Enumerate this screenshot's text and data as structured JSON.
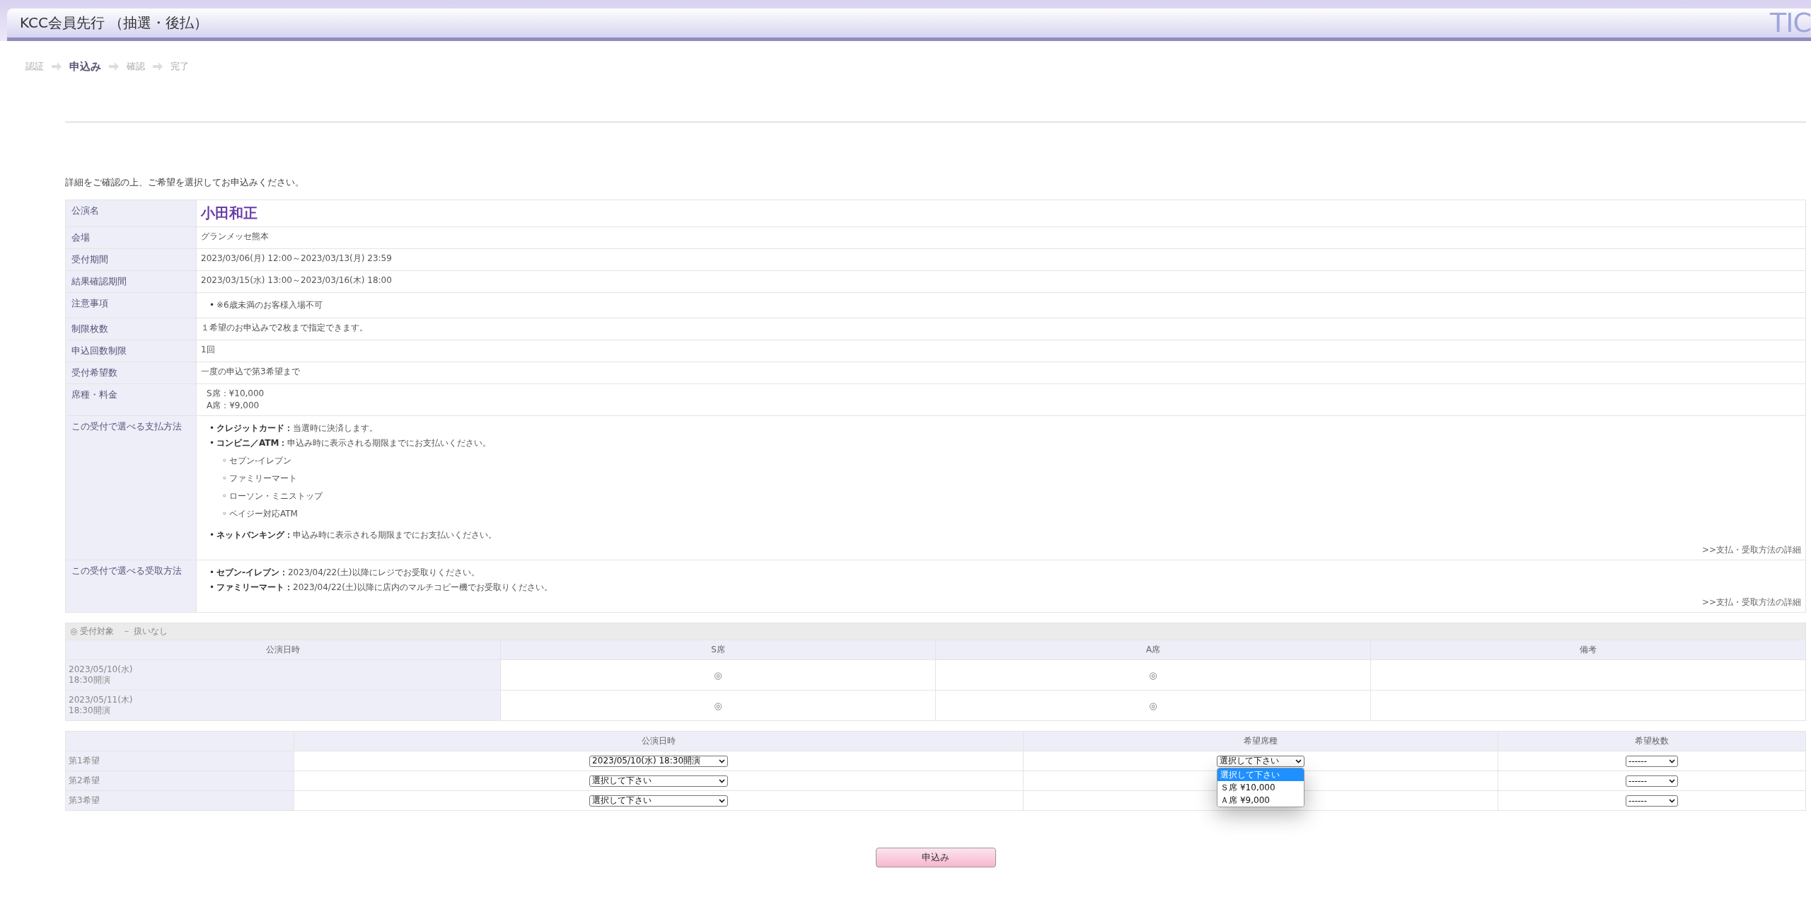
{
  "header": {
    "title": "KCC会員先行 （抽選・後払）",
    "logo": "TIC"
  },
  "steps": [
    {
      "label": "認証",
      "selected": false
    },
    {
      "label": "申込み",
      "selected": true
    },
    {
      "label": "確認",
      "selected": false
    },
    {
      "label": "完了",
      "selected": false
    }
  ],
  "intro": "詳細をご確認の上、ご希望を選択してお申込みください。",
  "details": [
    {
      "label": "公演名",
      "kind": "title",
      "value": "小田和正"
    },
    {
      "label": "会場",
      "kind": "text",
      "value": "グランメッセ熊本"
    },
    {
      "label": "受付期間",
      "kind": "text",
      "value": "2023/03/06(月) 12:00～2023/03/13(月) 23:59"
    },
    {
      "label": "結果確認期間",
      "kind": "text",
      "value": "2023/03/15(水) 13:00～2023/03/16(木) 18:00"
    },
    {
      "label": "注意事項",
      "kind": "list",
      "items": [
        {
          "marker": "•",
          "text": "※6歳未満のお客様入場不可"
        }
      ]
    },
    {
      "label": "制限枚数",
      "kind": "text",
      "value": "１希望のお申込みで2枚まで指定できます。"
    },
    {
      "label": "申込回数制限",
      "kind": "text",
      "value": "1回"
    },
    {
      "label": "受付希望数",
      "kind": "text",
      "value": "一度の申込で第3希望まで"
    },
    {
      "label": "席種・料金",
      "kind": "lines",
      "lines": [
        "S席：¥10,000",
        "A席：¥9,000"
      ]
    },
    {
      "label": "この受付で選べる支払方法",
      "kind": "list",
      "items": [
        {
          "marker": "•",
          "term": "クレジットカード：",
          "text": "当選時に決済します。"
        },
        {
          "marker": "•",
          "term": "コンビニ／ATM：",
          "text": "申込み時に表示される期限までにお支払いください。",
          "children": [
            {
              "marker": "◦",
              "text": "セブン-イレブン"
            },
            {
              "marker": "◦",
              "text": "ファミリーマート"
            },
            {
              "marker": "◦",
              "text": "ローソン・ミニストップ"
            },
            {
              "marker": "◦",
              "text": "ペイジー対応ATM"
            }
          ]
        },
        {
          "marker": "•",
          "term": "ネットバンキング：",
          "text": "申込み時に表示される期限までにお支払いください。"
        }
      ],
      "link": ">>支払・受取方法の詳細"
    },
    {
      "label": "この受付で選べる受取方法",
      "kind": "list",
      "items": [
        {
          "marker": "•",
          "term": "セブン-イレブン：",
          "text": "2023/04/22(土)以降にレジでお受取りください。"
        },
        {
          "marker": "•",
          "term": "ファミリーマート：",
          "text": "2023/04/22(土)以降に店内のマルチコピー機でお受取りください。"
        }
      ],
      "link": ">>支払・受取方法の詳細"
    }
  ],
  "availability": {
    "legend": "◎ 受付対象　－ 扱いなし",
    "columns": [
      "公演日時",
      "S席",
      "A席",
      "備考"
    ],
    "rows": [
      {
        "cells": [
          "2023/05/10(水)\n18:30開演",
          "◎",
          "◎",
          ""
        ]
      },
      {
        "cells": [
          "2023/05/11(木)\n18:30開演",
          "◎",
          "◎",
          ""
        ]
      }
    ]
  },
  "choices": {
    "columns": [
      "公演日時",
      "希望席種",
      "希望枚数"
    ],
    "rows": [
      {
        "label": "第1希望",
        "date": "2023/05/10(水) 18:30開演",
        "seat": "選択して下さい",
        "count": "------",
        "seat_options": [
          {
            "label": "選択して下さい",
            "selected": true
          },
          {
            "label": "Ｓ席 ¥10,000",
            "selected": false
          },
          {
            "label": "Ａ席 ¥9,000",
            "selected": false
          }
        ]
      },
      {
        "label": "第2希望",
        "date": "選択して下さい",
        "count": "------"
      },
      {
        "label": "第3希望",
        "date": "選択して下さい",
        "count": "------"
      }
    ]
  },
  "submit": "申込み"
}
